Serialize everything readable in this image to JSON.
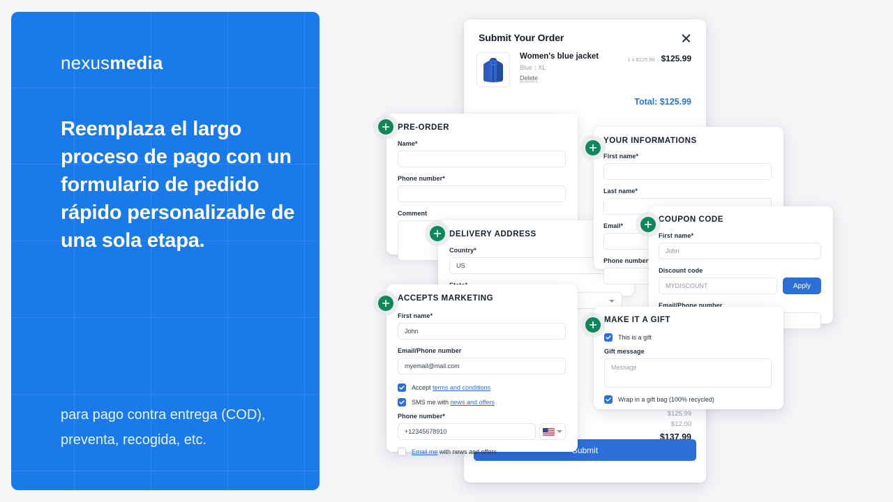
{
  "promo": {
    "logo_light": "nexus",
    "logo_bold": "media",
    "headline": "Reemplaza el largo proceso de pago con un formulario de pedido rápido personalizable de una sola etapa.",
    "subtext": "para pago contra entrega (COD), preventa, recogida, etc.",
    "bg_color": "#1a7aea"
  },
  "order": {
    "title": "Submit Your Order",
    "close_icon": "close-icon",
    "item": {
      "thumb_icon": "jacket-thumbnail",
      "name": "Women's blue jacket",
      "color": "Blue",
      "separator": "|",
      "size": "XL",
      "delete_label": "Delete",
      "unit_line": "1 x $125.99",
      "line_total": "$125.99"
    },
    "total_label": "Total: $125.99",
    "summary": {
      "subtotal": "$125.99",
      "shipping": "$12.00",
      "grand_total": "$137.99"
    },
    "submit_label": "Submit",
    "accent_color": "#2c6fd8"
  },
  "preorder": {
    "title": "PRE-ORDER",
    "badge_icon": "plus-icon",
    "fields": [
      {
        "label": "Name*",
        "value": ""
      },
      {
        "label": "Phone number*",
        "value": ""
      },
      {
        "label": "Comment",
        "value": ""
      }
    ]
  },
  "delivery": {
    "title": "DELIVERY ADDRESS",
    "badge_icon": "plus-icon",
    "country_label": "Country*",
    "country_value": "US",
    "state_label": "State*",
    "state_value": "",
    "chevron_icon": "chevron-down-icon"
  },
  "info": {
    "title": "YOUR INFORMATIONS",
    "badge_icon": "plus-icon",
    "fields": [
      {
        "label": "First name*",
        "value": ""
      },
      {
        "label": "Last name*",
        "value": ""
      },
      {
        "label": "Email*",
        "value": ""
      },
      {
        "label": "Phone number*",
        "value": ""
      }
    ]
  },
  "coupon": {
    "title": "COUPON CODE",
    "badge_icon": "plus-icon",
    "first_name_label": "First name*",
    "first_name_placeholder": "John",
    "discount_label": "Discount code",
    "discount_placeholder": "MYDISCOUNT",
    "apply_label": "Apply",
    "email_label": "Email/Phone number",
    "email_value": ""
  },
  "marketing": {
    "title": "ACCEPTS MARKETING",
    "badge_icon": "plus-icon",
    "first_name_label": "First name*",
    "first_name_value": "John",
    "email_label": "Email/Phone number",
    "email_value": "myemail@mail.com",
    "accept_prefix": "Accept",
    "accept_link": "terms and conditions",
    "sms_prefix": "SMS me with",
    "sms_link": "news and offers",
    "phone_label": "Phone number*",
    "phone_value": "+12345678910",
    "flag_icon": "us-flag-icon",
    "chevron_icon": "chevron-down-icon",
    "emailme_link": "Email me",
    "emailme_suffix": "with news and offers"
  },
  "gift": {
    "title": "MAKE IT A GIFT",
    "badge_icon": "plus-icon",
    "is_gift_label": "This is a gift",
    "message_label": "Gift message",
    "message_placeholder": "Message",
    "wrap_label": "Wrap in a gift bag (100% recycled)"
  }
}
